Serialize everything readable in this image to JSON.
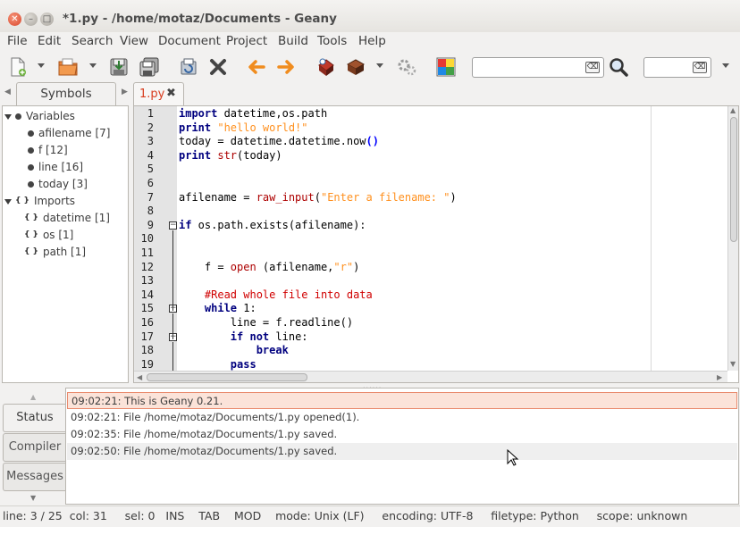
{
  "window": {
    "title": "*1.py - /home/motaz/Documents - Geany",
    "buttons": {
      "close": "✕",
      "minimize": "–",
      "maximize": "□"
    }
  },
  "menu": [
    "File",
    "Edit",
    "Search",
    "View",
    "Document",
    "Project",
    "Build",
    "Tools",
    "Help"
  ],
  "toolbar": {
    "icons": [
      "new-file-icon",
      "open-file-icon",
      "save-icon",
      "save-all-icon",
      "revert-icon",
      "close-icon",
      "back-icon",
      "forward-icon",
      "compile-icon",
      "build-icon",
      "execute-icon",
      "color-chooser-icon",
      "find-icon"
    ],
    "search_value": "",
    "goto_value": "",
    "clear_glyph": "⌫"
  },
  "sidebar": {
    "tab_label": "Symbols",
    "nav_left": "◀",
    "nav_right": "▶",
    "tree": [
      {
        "label": "Variables",
        "level": 0,
        "kind": "group-dot"
      },
      {
        "label": "afilename [7]",
        "level": 1,
        "kind": "dot"
      },
      {
        "label": "f [12]",
        "level": 1,
        "kind": "dot"
      },
      {
        "label": "line [16]",
        "level": 1,
        "kind": "dot"
      },
      {
        "label": "today [3]",
        "level": 1,
        "kind": "dot"
      },
      {
        "label": "Imports",
        "level": 0,
        "kind": "group-brace"
      },
      {
        "label": "datetime [1]",
        "level": 1,
        "kind": "brace"
      },
      {
        "label": "os [1]",
        "level": 1,
        "kind": "brace"
      },
      {
        "label": "path [1]",
        "level": 1,
        "kind": "brace"
      }
    ],
    "brace_glyph": "{ }"
  },
  "editor": {
    "tab_label": "1.py",
    "tab_close": "✖",
    "line_numbers": [
      "1",
      "2",
      "3",
      "4",
      "5",
      "6",
      "7",
      "8",
      "9",
      "10",
      "11",
      "12",
      "13",
      "14",
      "15",
      "16",
      "17",
      "18",
      "19"
    ],
    "lines": [
      [
        {
          "t": "import",
          "c": "kw"
        },
        {
          "t": " datetime,os.path",
          "c": ""
        }
      ],
      [
        {
          "t": "print",
          "c": "kw"
        },
        {
          "t": " ",
          "c": ""
        },
        {
          "t": "\"hello world!\"",
          "c": "str"
        }
      ],
      [
        {
          "t": "today = datetime.datetime.now",
          "c": ""
        },
        {
          "t": "()",
          "c": "bracket"
        }
      ],
      [
        {
          "t": "print",
          "c": "kw"
        },
        {
          "t": " ",
          "c": ""
        },
        {
          "t": "str",
          "c": "fn"
        },
        {
          "t": "(today)",
          "c": ""
        }
      ],
      [],
      [],
      [
        {
          "t": "afilename = ",
          "c": ""
        },
        {
          "t": "raw_input",
          "c": "fn"
        },
        {
          "t": "(",
          "c": ""
        },
        {
          "t": "\"Enter a filename: \"",
          "c": "str"
        },
        {
          "t": ")",
          "c": ""
        }
      ],
      [],
      [
        {
          "t": "if",
          "c": "kw"
        },
        {
          "t": " os.path.exists(afilename):",
          "c": ""
        }
      ],
      [],
      [],
      [
        {
          "t": "    f = ",
          "c": ""
        },
        {
          "t": "open",
          "c": "fn"
        },
        {
          "t": " (afilename,",
          "c": ""
        },
        {
          "t": "\"r\"",
          "c": "str"
        },
        {
          "t": ")",
          "c": ""
        }
      ],
      [],
      [
        {
          "t": "    #Read whole file into data",
          "c": "cmt"
        }
      ],
      [
        {
          "t": "    ",
          "c": ""
        },
        {
          "t": "while",
          "c": "kw"
        },
        {
          "t": " 1:",
          "c": ""
        }
      ],
      [
        {
          "t": "        line = f.readline()",
          "c": ""
        }
      ],
      [
        {
          "t": "        ",
          "c": ""
        },
        {
          "t": "if",
          "c": "kw"
        },
        {
          "t": " ",
          "c": ""
        },
        {
          "t": "not",
          "c": "kw"
        },
        {
          "t": " line:",
          "c": ""
        }
      ],
      [
        {
          "t": "            ",
          "c": ""
        },
        {
          "t": "break",
          "c": "kw"
        }
      ],
      [
        {
          "t": "        ",
          "c": ""
        },
        {
          "t": "pass",
          "c": "kw"
        }
      ]
    ],
    "fold_minus": "−"
  },
  "messages": {
    "tabs": [
      "Status",
      "Compiler",
      "Messages"
    ],
    "active_tab": "Status",
    "rows": [
      "09:02:21: This is Geany 0.21.",
      "09:02:21: File /home/motaz/Documents/1.py opened(1).",
      "09:02:35: File /home/motaz/Documents/1.py saved.",
      "09:02:50: File /home/motaz/Documents/1.py saved."
    ],
    "scroll_up": "▲",
    "scroll_down": "▼"
  },
  "statusbar": {
    "text": "line: 3 / 25  col: 31     sel: 0   INS    TAB    MOD    mode: Unix (LF)     encoding: UTF-8     filetype: Python     scope: unknown"
  },
  "colors": {
    "keyword": "#00007f",
    "string": "#ff901e",
    "comment": "#d00000",
    "builtin": "#ad0000",
    "tab_label_modified": "#d83c1e",
    "message_highlight": "#fbe3d9"
  }
}
